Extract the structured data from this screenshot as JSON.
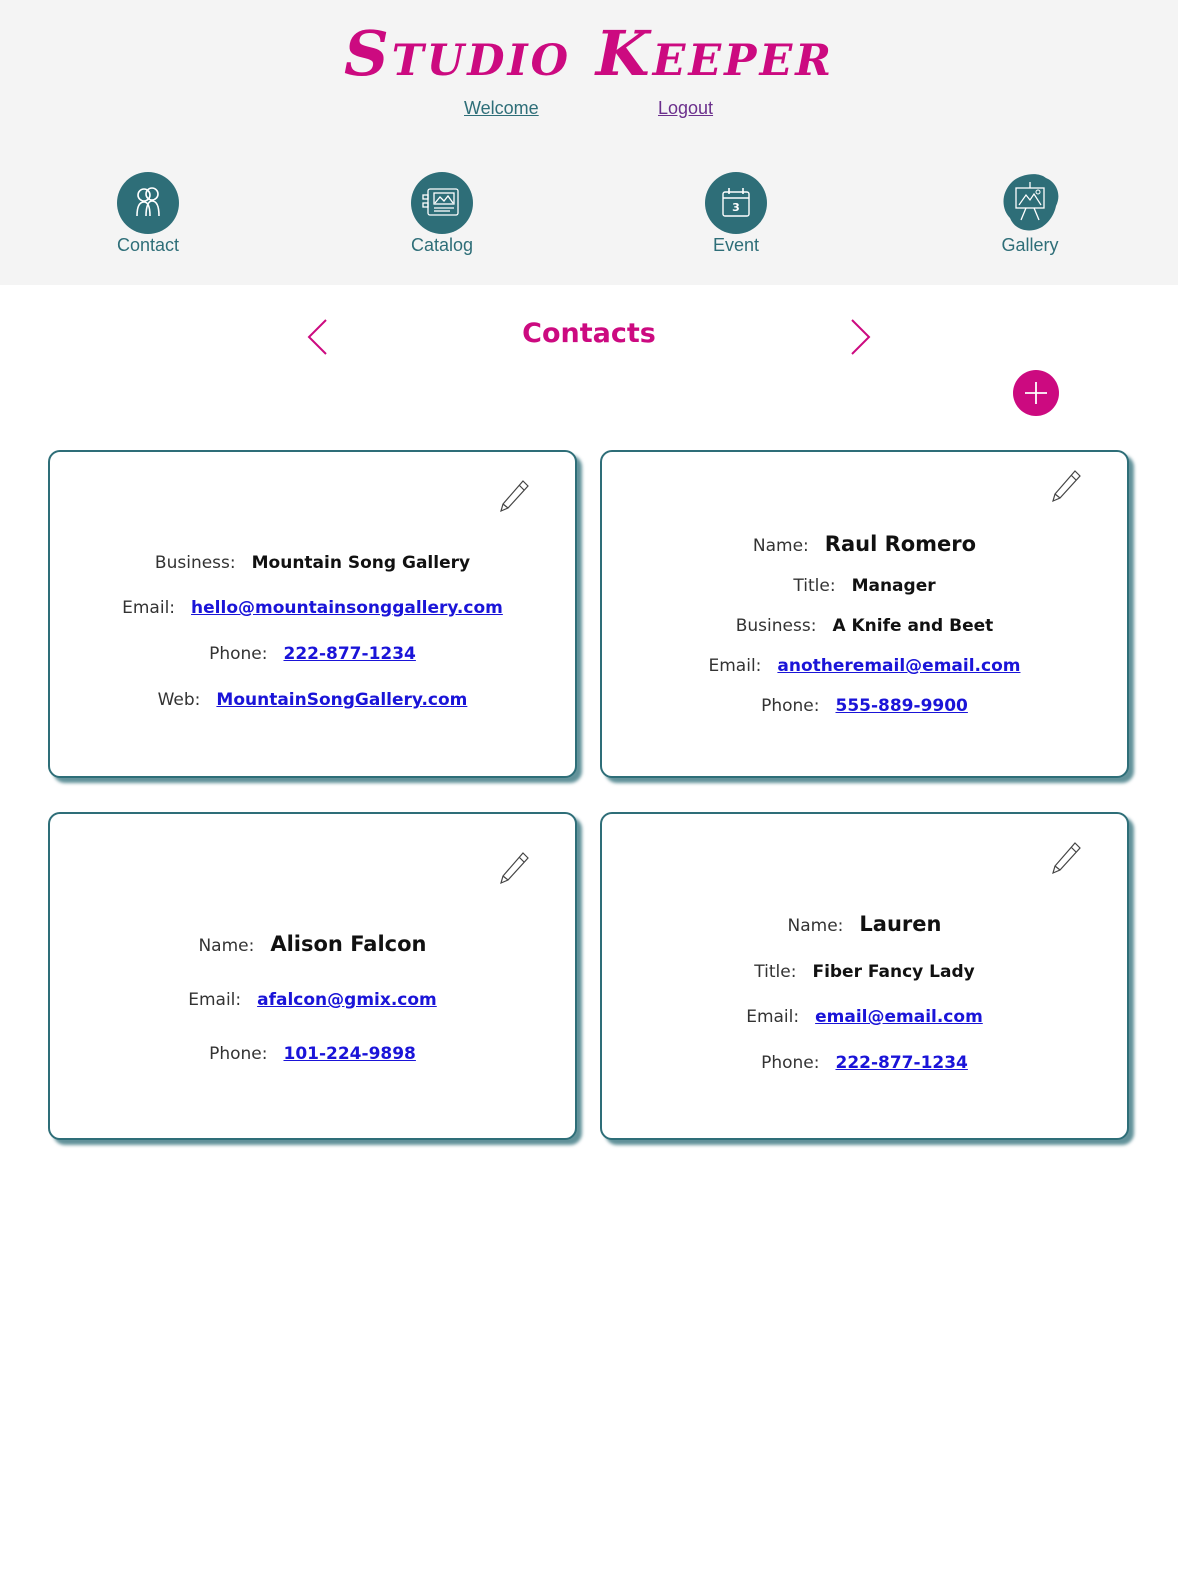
{
  "app": {
    "title": "Studio Keeper",
    "links": {
      "welcome": "Welcome",
      "logout": "Logout"
    }
  },
  "nav": [
    {
      "label": "Contact",
      "icon": "contacts-icon"
    },
    {
      "label": "Catalog",
      "icon": "catalog-icon"
    },
    {
      "label": "Event",
      "icon": "calendar-icon",
      "day": "3"
    },
    {
      "label": "Gallery",
      "icon": "gallery-easel-icon"
    }
  ],
  "page": {
    "title": "Contacts"
  },
  "colors": {
    "brand": "#cc0a80",
    "teal": "#2e6e78",
    "link": "#1a14d8"
  },
  "cards": [
    {
      "rows": [
        {
          "label": "Business:",
          "value": "Mountain Song Gallery",
          "type": "text"
        },
        {
          "label": "Email:",
          "value": "hello@mountainsonggallery.com",
          "type": "link"
        },
        {
          "label": "Phone:",
          "value": "222-877-1234",
          "type": "link"
        },
        {
          "label": "Web:",
          "value": "MountainSongGallery.com",
          "type": "link"
        }
      ]
    },
    {
      "rows": [
        {
          "label": "Name:",
          "value": "Raul Romero",
          "type": "name"
        },
        {
          "label": "Title:",
          "value": "Manager",
          "type": "text"
        },
        {
          "label": "Business:",
          "value": "A Knife and Beet",
          "type": "text"
        },
        {
          "label": "Email:",
          "value": "anotheremail@email.com",
          "type": "link"
        },
        {
          "label": "Phone:",
          "value": "555-889-9900",
          "type": "link"
        }
      ]
    },
    {
      "rows": [
        {
          "label": "Name:",
          "value": "Alison Falcon",
          "type": "name"
        },
        {
          "label": "Email:",
          "value": "afalcon@gmix.com",
          "type": "link"
        },
        {
          "label": "Phone:",
          "value": "101-224-9898",
          "type": "link"
        }
      ]
    },
    {
      "rows": [
        {
          "label": "Name:",
          "value": "Lauren",
          "type": "name"
        },
        {
          "label": "Title:",
          "value": "Fiber Fancy Lady",
          "type": "text"
        },
        {
          "label": "Email:",
          "value": "email@email.com",
          "type": "link"
        },
        {
          "label": "Phone:",
          "value": "222-877-1234",
          "type": "link"
        }
      ]
    }
  ]
}
